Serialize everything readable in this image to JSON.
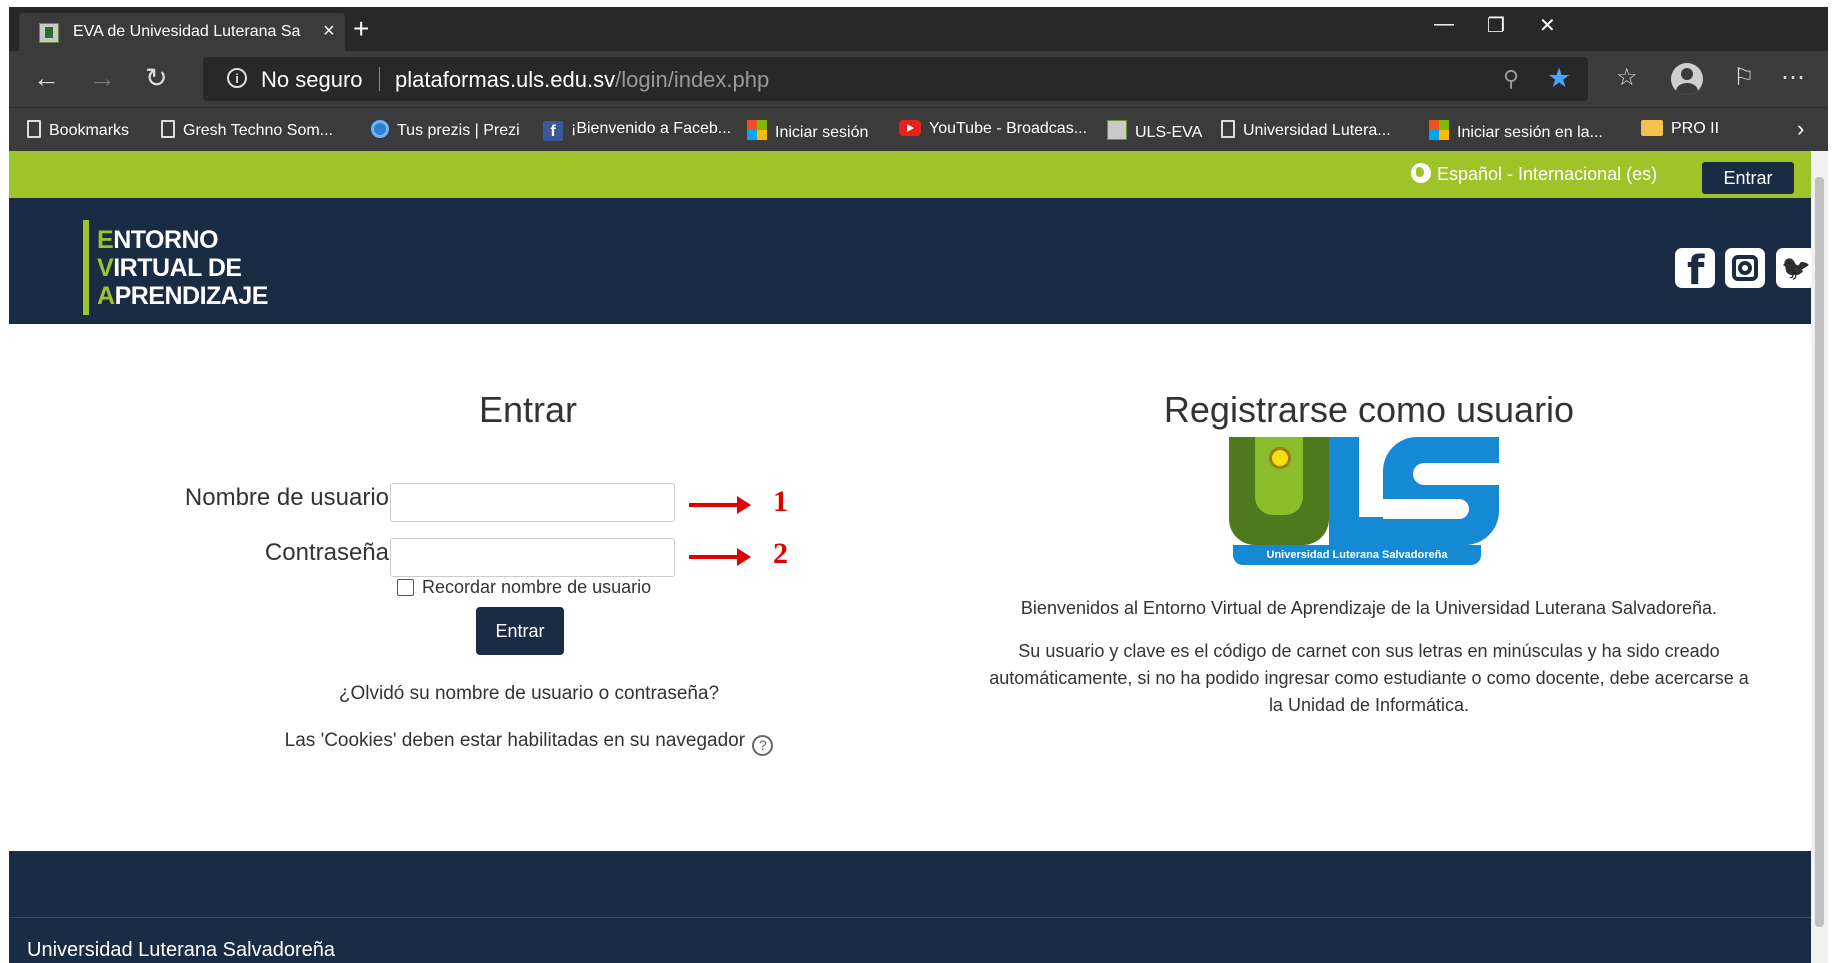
{
  "browser": {
    "tab_title": "EVA de Univesidad Luterana Salv",
    "new_tab": "+",
    "window_controls": {
      "minimize": "—",
      "restore": "❐",
      "close": "✕"
    },
    "security_label": "No seguro",
    "url_host": "plataformas.uls.edu.sv",
    "url_path": "/login/index.php",
    "bookmarks": [
      {
        "label": "Bookmarks",
        "icon": "page-icon"
      },
      {
        "label": "Gresh Techno Som...",
        "icon": "page-icon"
      },
      {
        "label": "Tus prezis | Prezi",
        "icon": "prezi-icon"
      },
      {
        "label": "¡Bienvenido a Faceb...",
        "icon": "facebook-icon"
      },
      {
        "label": "Iniciar sesión",
        "icon": "microsoft-icon"
      },
      {
        "label": "YouTube - Broadcas...",
        "icon": "youtube-icon"
      },
      {
        "label": "ULS-EVA",
        "icon": "uls-icon"
      },
      {
        "label": "Universidad Lutera...",
        "icon": "page-icon"
      },
      {
        "label": "Iniciar sesión en la...",
        "icon": "microsoft-icon"
      },
      {
        "label": "PRO II",
        "icon": "folder-icon"
      }
    ],
    "bookmarks_more": "›"
  },
  "topbar": {
    "language": "Español - Internacional (es)",
    "login_button": "Entrar"
  },
  "header": {
    "logo_lines": [
      {
        "initial": "E",
        "rest": "NTORNO"
      },
      {
        "initial": "V",
        "rest": "IRTUAL DE"
      },
      {
        "initial": "A",
        "rest": "PRENDIZAJE"
      }
    ],
    "social": [
      "facebook-icon",
      "instagram-icon",
      "twitter-icon"
    ]
  },
  "login": {
    "heading": "Entrar",
    "username_label": "Nombre de usuario",
    "username_value": "",
    "password_label": "Contraseña",
    "password_value": "",
    "annotation_1": "1",
    "annotation_2": "2",
    "remember_label": "Recordar nombre de usuario",
    "submit_label": "Entrar",
    "forgot_link": "¿Olvidó su nombre de usuario o contraseña?",
    "cookies_text": "Las 'Cookies' deben estar habilitadas en su navegador",
    "help_symbol": "?"
  },
  "register": {
    "heading": "Registrarse como usuario",
    "logo_caption": "Universidad Luterana Salvadoreña",
    "welcome": "Bienvenidos al Entorno Virtual de Aprendizaje de la Universidad Luterana Salvadoreña.",
    "info": "Su usuario y clave es el código de carnet con sus letras en minúsculas y ha sido creado automáticamente, si no ha podido ingresar como estudiante o como docente, debe acercarse a la Unidad de Informática."
  },
  "footer": {
    "text": "Universidad Luterana Salvadoreña"
  },
  "colors": {
    "accent_green": "#9dc52a",
    "navy": "#1a2b44",
    "annotation_red": "#e00000"
  }
}
